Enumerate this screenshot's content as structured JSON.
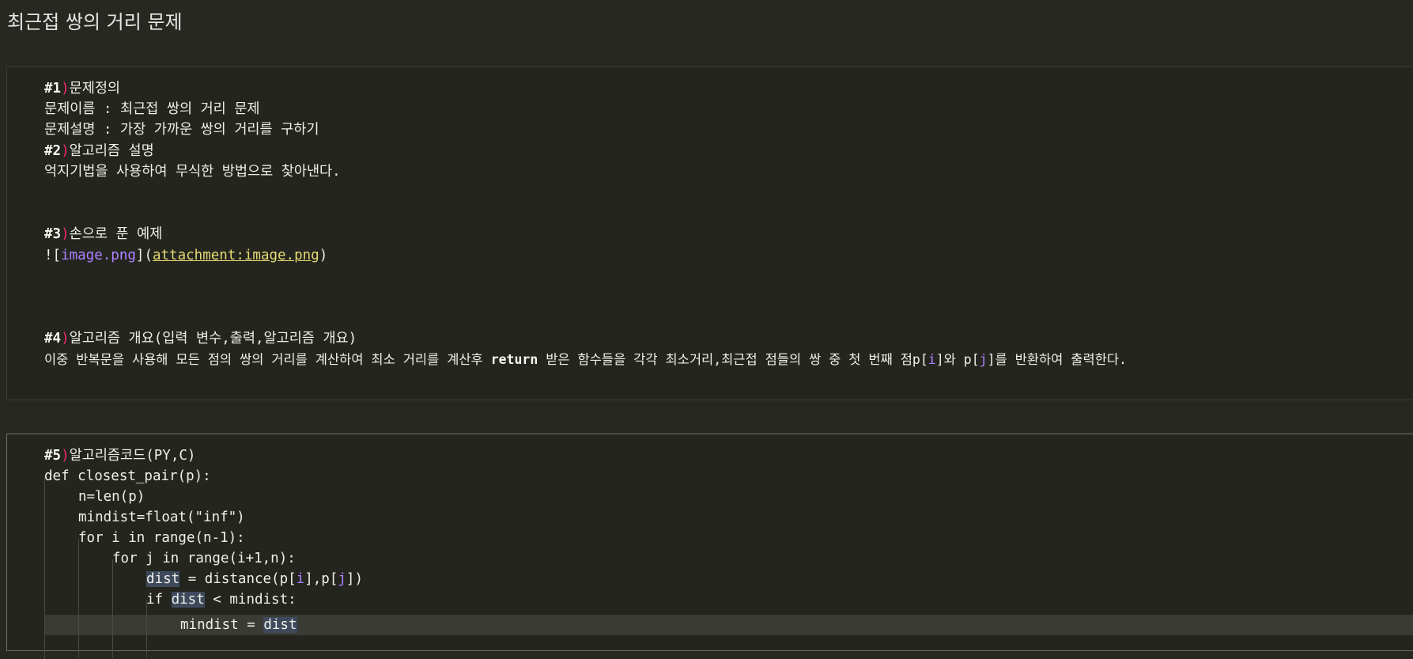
{
  "page": {
    "title": "최근접 쌍의 거리 문제"
  },
  "markdown_cell": {
    "h1_marker": "#1",
    "h1_paren": ")",
    "h1_text": "문제정의",
    "problem_name": "문제이름 : 최근접 쌍의 거리 문제",
    "problem_desc": "문제설명 : 가장 가까운 쌍의 거리를 구하기",
    "h2_marker": "#2",
    "h2_paren": ")",
    "h2_text": "알고리즘 설명",
    "algo_desc": "억지기법을 사용하여 무식한 방법으로 찾아낸다.",
    "h3_marker": "#3",
    "h3_paren": ")",
    "h3_text": "손으로 푼 예제",
    "img_bang": "![",
    "img_alt": "image.png",
    "img_mid": "](",
    "img_src": "attachment:image.png",
    "img_end": ")",
    "h4_marker": "#4",
    "h4_paren": ")",
    "h4_text": "알고리즘 개요(입력 변수,출력,알고리즘 개요)",
    "overview_a": "이중 반복문을 사용해 모든 점의 쌍의 거리를 계산하여 최소 거리를 계산후 ",
    "overview_return": "return",
    "overview_b": " 받은 함수들을 각각 최소거리,최근접 점들의 쌍 중 첫 번째 점",
    "overview_p1": "p[",
    "overview_i": "i",
    "overview_p1_end": "]",
    "overview_and": "와 ",
    "overview_p2": "p[",
    "overview_j": "j",
    "overview_p2_end": "]",
    "overview_c": "를 반환하여 출력한다."
  },
  "code_cell": {
    "h5_marker": "#5",
    "h5_paren": ")",
    "h5_text": "알고리즘코드(PY,C)",
    "line_def": "def closest_pair(p):",
    "line_n": "n=len(p)",
    "line_mindist": "mindist=float(\"inf\")",
    "line_for_i": "for i in range(n-1):",
    "line_for_j": "for j in range(i+1,n):",
    "dist_word": "dist",
    "dist_rest_a": " = distance(p[",
    "dist_i": "i",
    "dist_rest_b": "],p[",
    "dist_j": "j",
    "dist_rest_c": "])",
    "if_a": "if ",
    "if_dist": "dist",
    "if_b": " < mindist:",
    "assign_a": "mindist = ",
    "assign_dist": "dist"
  }
}
